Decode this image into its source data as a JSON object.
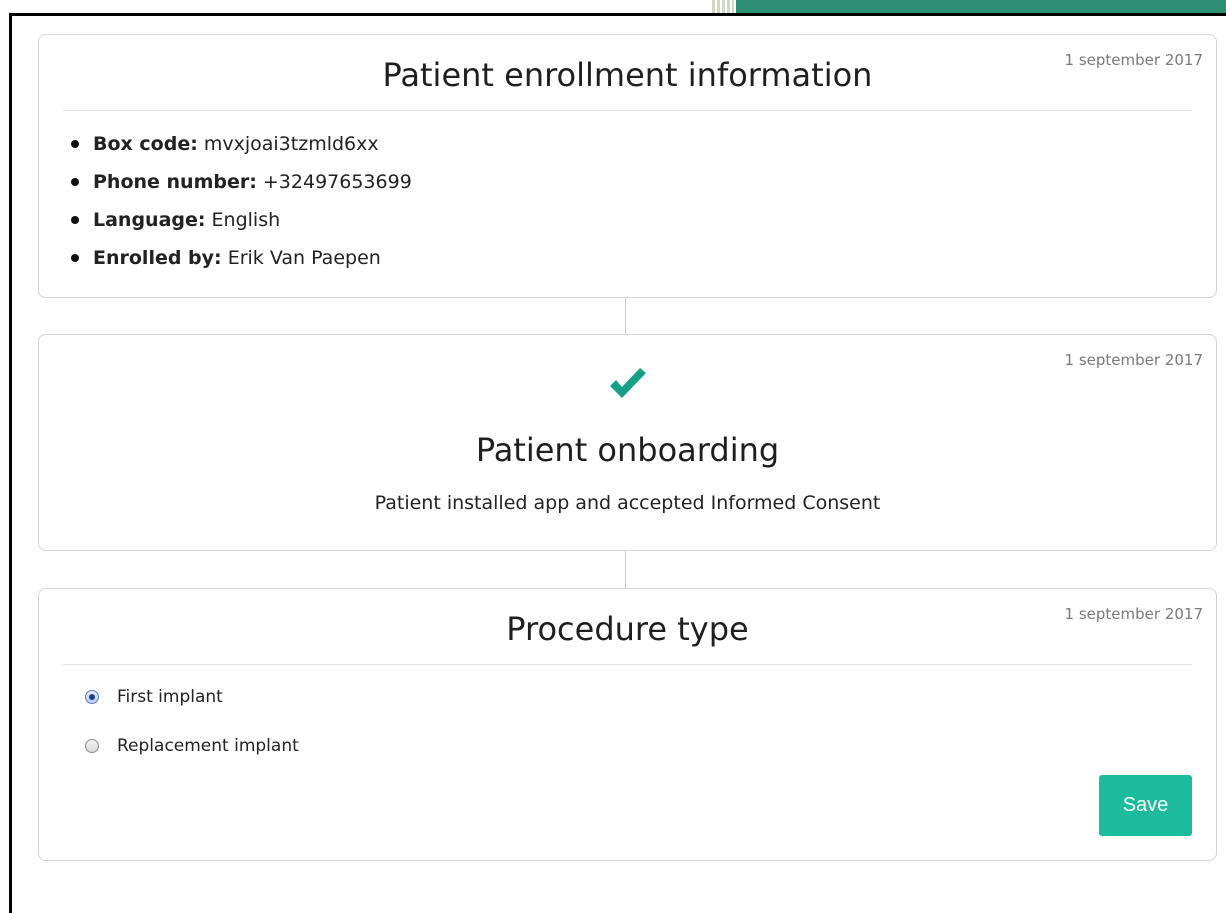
{
  "enrollment": {
    "title": "Patient enrollment information",
    "date": "1 september 2017",
    "fields": [
      {
        "label": "Box code:",
        "value": "mvxjoai3tzmld6xx"
      },
      {
        "label": "Phone number:",
        "value": "+32497653699"
      },
      {
        "label": "Language:",
        "value": "English"
      },
      {
        "label": "Enrolled by:",
        "value": "Erik Van Paepen"
      }
    ]
  },
  "onboarding": {
    "title": "Patient onboarding",
    "date": "1 september 2017",
    "status_icon": "checkmark-icon",
    "description": "Patient installed app and accepted Informed Consent"
  },
  "procedure": {
    "title": "Procedure type",
    "date": "1 september 2017",
    "options": [
      {
        "label": "First implant",
        "selected": true
      },
      {
        "label": "Replacement implant",
        "selected": false
      }
    ],
    "save_label": "Save"
  },
  "colors": {
    "accent": "#1abc9c",
    "check": "#16a085",
    "topbar": "#2f8f73"
  }
}
